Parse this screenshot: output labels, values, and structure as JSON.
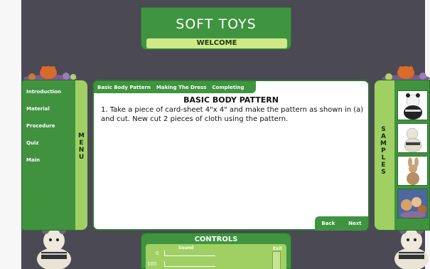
{
  "header": {
    "title": "SOFT TOYS",
    "subtitle": "WELCOME"
  },
  "menu": {
    "items": [
      {
        "label": "Introduction"
      },
      {
        "label": "Material"
      },
      {
        "label": "Procedure"
      },
      {
        "label": "Quiz"
      },
      {
        "label": "Main"
      }
    ],
    "band_letters": [
      "M",
      "E",
      "N",
      "U"
    ]
  },
  "samples": {
    "band_letters": [
      "S",
      "A",
      "M",
      "P",
      "L",
      "E",
      "S"
    ],
    "thumbnails": [
      "panda-toy-icon",
      "sheep-toy-icon",
      "bunny-toy-icon",
      "toy-group-icon"
    ]
  },
  "content": {
    "tabs": [
      {
        "label": "Basic Body Pattern"
      },
      {
        "label": "Making The Dress"
      },
      {
        "label": "Completing"
      }
    ],
    "title": "BASIC BODY PATTERN",
    "body": "1. Take a piece of card-sheet 4\"x 4\" and make the pattern as shown in (a) and cut. New cut 2 pieces of cloth using the pattern."
  },
  "nav": {
    "back_label": "Back",
    "next_label": "Next"
  },
  "controls": {
    "title": "CONTROLS",
    "sound_label": "Sound",
    "exit_label": "Exit",
    "volume_values": [
      "0",
      "100"
    ]
  },
  "colors": {
    "panel_green": "#3f9440",
    "band_green": "#a0d064",
    "background": "#4b4954"
  }
}
